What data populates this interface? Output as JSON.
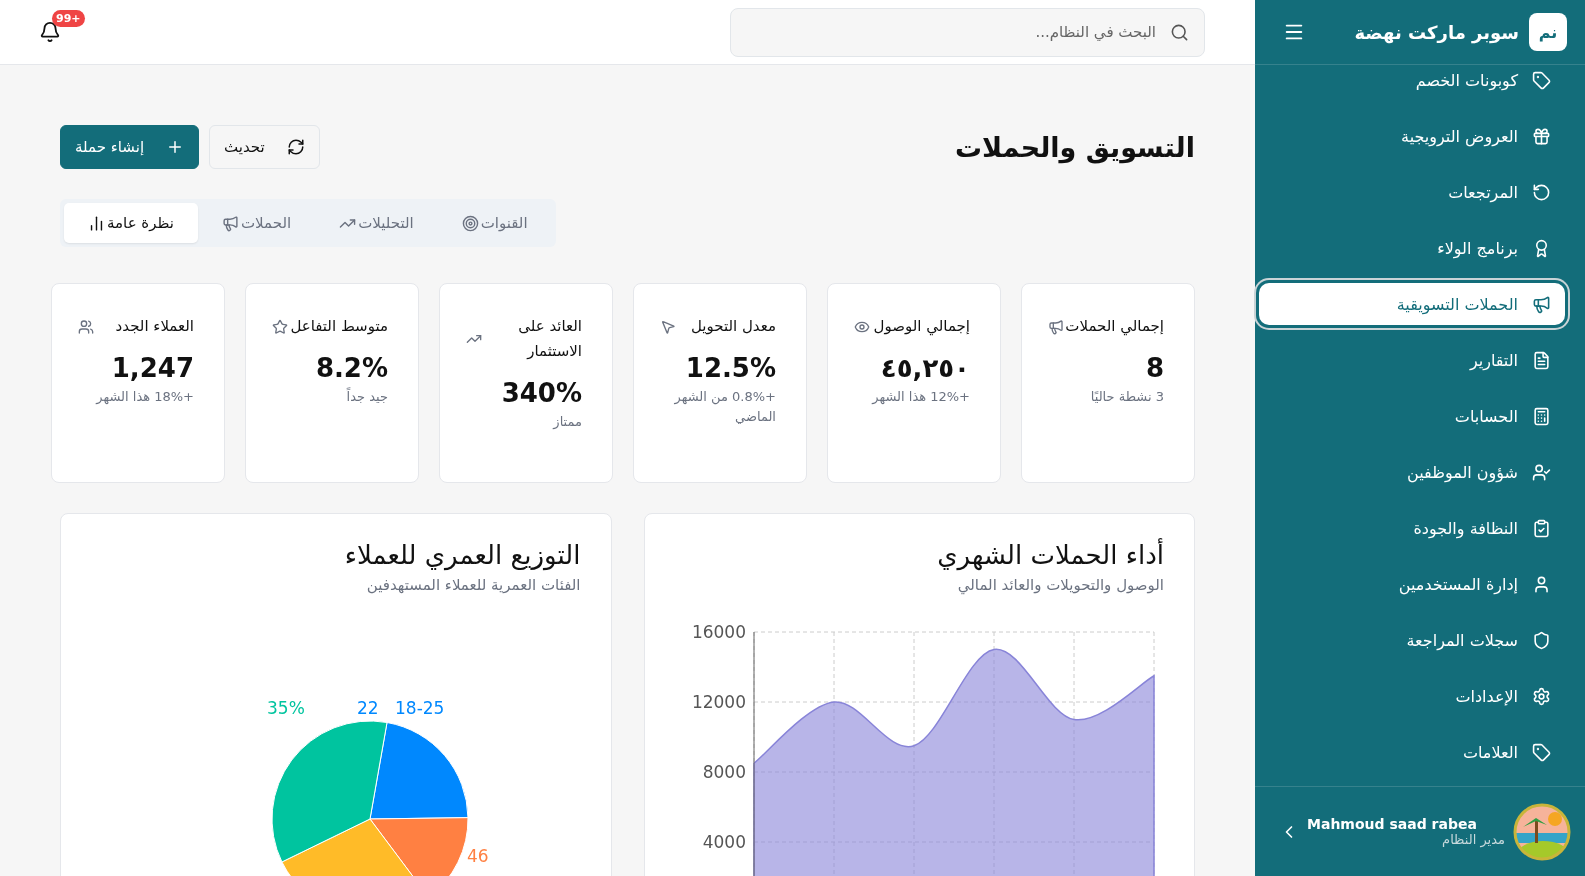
{
  "header": {
    "search": {
      "placeholder": "البحث في النظام..."
    },
    "notifications": {
      "badge": "99+"
    }
  },
  "sidebar": {
    "brand": {
      "logo": "نم",
      "name": "سوبر ماركت نهضة"
    },
    "items": [
      {
        "label": "كوبونات الخصم",
        "selected": false
      },
      {
        "label": "العروض الترويجية",
        "selected": false
      },
      {
        "label": "المرتجعات",
        "selected": false
      },
      {
        "label": "برنامج الولاء",
        "selected": false
      },
      {
        "label": "الحملات التسويقية",
        "selected": true
      },
      {
        "label": "التقارير",
        "selected": false
      },
      {
        "label": "الحسابات",
        "selected": false
      },
      {
        "label": "شؤون الموظفين",
        "selected": false
      },
      {
        "label": "النظافة والجودة",
        "selected": false
      },
      {
        "label": "إدارة المستخدمين",
        "selected": false
      },
      {
        "label": "سجلات المراجعة",
        "selected": false
      },
      {
        "label": "الإعدادات",
        "selected": false
      },
      {
        "label": "العلامات",
        "selected": false
      }
    ],
    "user": {
      "name": "Mahmoud saad rabea",
      "role": "مدير النظام"
    }
  },
  "page": {
    "title": "التسويق والحملات",
    "buttons": [
      {
        "label": "تحديث",
        "kind": "secondary"
      },
      {
        "label": "إنشاء حملة",
        "kind": "primary"
      }
    ]
  },
  "tabs": [
    {
      "label": "القنوات",
      "selected": false
    },
    {
      "label": "التحليلات",
      "selected": false
    },
    {
      "label": "الحملات",
      "selected": false
    },
    {
      "label": "نظرة عامة",
      "selected": true
    }
  ],
  "stats": [
    {
      "title": "إجمالي الحملات",
      "value": "8",
      "note": "3 نشطة حاليًا"
    },
    {
      "title": "إجمالي الوصول",
      "value": "٤٥,٢٥٠",
      "note": "+12% هذا الشهر"
    },
    {
      "title": "معدل التحويل",
      "value": "12.5%",
      "note": "+0.8% من الشهر الماضي"
    },
    {
      "title": "العائد على الاستثمار",
      "value": "340%",
      "note": "ممتاز"
    },
    {
      "title": "متوسط التفاعل",
      "value": "8.2%",
      "note": "جيد جداً"
    },
    {
      "title": "العملاء الجدد",
      "value": "1,247",
      "note": "+18% هذا الشهر"
    }
  ],
  "charts": [
    {
      "title": "أداء الحملات الشهري",
      "subtitle": "الوصول والتحويلات والعائد المالي",
      "chart_data": {
        "type": "area",
        "grid": true,
        "series": [
          {
            "color": "#8884d8",
            "values": [
              8500,
              12000,
              9500,
              15000,
              11000,
              13500
            ]
          }
        ],
        "ylim": [
          0,
          16000
        ],
        "yticks": [
          4000,
          8000,
          12000,
          16000
        ]
      }
    },
    {
      "title": "التوزيع العمري للعملاء",
      "subtitle": "الفئات العمرية للعملاء المستهدفين",
      "chart_data": {
        "type": "pie",
        "values": [
          22,
          15,
          28,
          35
        ],
        "colors": [
          "#0088fe",
          "#ff8042",
          "#ffbb28",
          "#00c49f"
        ],
        "annotations": [
          {
            "text": "35%"
          },
          {
            "text": "22"
          },
          {
            "text": "18-25"
          },
          {
            "text": "46"
          }
        ]
      }
    }
  ]
}
